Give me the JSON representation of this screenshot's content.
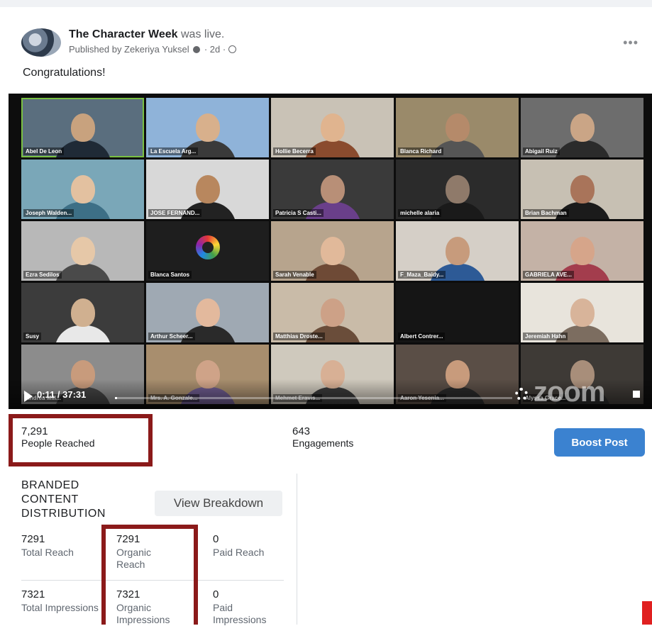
{
  "post": {
    "page_name": "The Character Week",
    "live_text": "was live.",
    "published_by": "Published by Zekeriya Yuksel",
    "time_ago": "2d",
    "body_text": "Congratulations!"
  },
  "video": {
    "time_display": "0:11 / 37:31",
    "progress_fraction": 0.005,
    "watermark": "zoom",
    "participants": [
      {
        "name": "Abel De Leon",
        "active": true
      },
      {
        "name": "La Escuela Arg..."
      },
      {
        "name": "Hollie Becerra"
      },
      {
        "name": "Blanca Richard"
      },
      {
        "name": "Abigail Ruiz"
      },
      {
        "name": "Joseph Walden..."
      },
      {
        "name": "JOSE FERNAND..."
      },
      {
        "name": "Patricia S Casti..."
      },
      {
        "name": "michelle alaria"
      },
      {
        "name": "Brian Bachman"
      },
      {
        "name": "Ezra Sedilos"
      },
      {
        "name": "Blanca Santos",
        "logo": true
      },
      {
        "name": "Sarah Venable"
      },
      {
        "name": "F_Maza_Baidy..."
      },
      {
        "name": "GABRIELA AVE..."
      },
      {
        "name": "Susy"
      },
      {
        "name": "Arthur Scheer..."
      },
      {
        "name": "Matthias Droste..."
      },
      {
        "name": "Albert Contrer..."
      },
      {
        "name": "Jeremiah Hahn"
      },
      {
        "name": "Andrea Mill..."
      },
      {
        "name": "Mrs. A. Gonzale..."
      },
      {
        "name": "Mehmet Eravis..."
      },
      {
        "name": "Aaron Yesenia..."
      },
      {
        "name": "Alyssa Grace..."
      }
    ]
  },
  "stats": {
    "people_reached_value": "7,291",
    "people_reached_label": "People Reached",
    "engagements_value": "643",
    "engagements_label": "Engagements",
    "boost_label": "Boost Post"
  },
  "branded": {
    "title": "BRANDED CONTENT DISTRIBUTION",
    "breakdown_label": "View Breakdown",
    "total_reach": {
      "value": "7291",
      "label": "Total Reach"
    },
    "organic_reach": {
      "value": "7291",
      "label": "Organic Reach"
    },
    "paid_reach": {
      "value": "0",
      "label": "Paid Reach"
    },
    "total_impressions": {
      "value": "7321",
      "label": "Total Impressions"
    },
    "organic_impressions": {
      "value": "7321",
      "label": "Organic Impressions"
    },
    "paid_impressions": {
      "value": "0",
      "label": "Paid Impressions"
    }
  },
  "colors": {
    "highlight": "#8b1a1a",
    "boost": "#3b82d0",
    "active_speaker": "#7ac143"
  }
}
